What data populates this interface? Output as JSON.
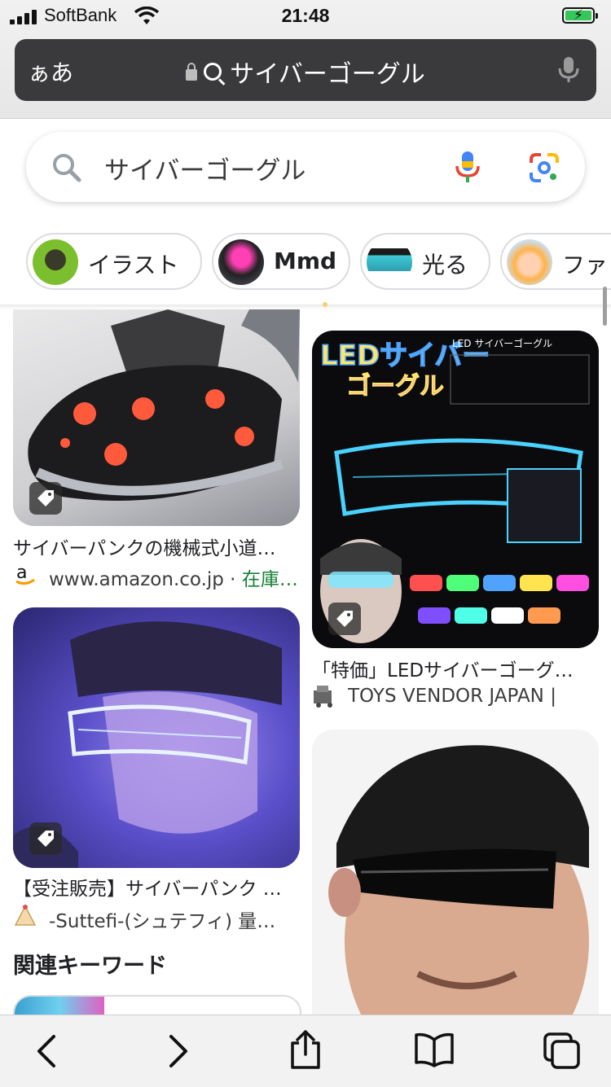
{
  "status_bar": {
    "carrier": "SoftBank",
    "time": "21:48"
  },
  "safari": {
    "text_size_button": "ぁあ",
    "address": "サイバーゴーグル"
  },
  "search": {
    "query": "サイバーゴーグル"
  },
  "chips": [
    {
      "label": "イラスト"
    },
    {
      "label": "Mmd"
    },
    {
      "label": "光る"
    },
    {
      "label": "ファ"
    }
  ],
  "results": [
    {
      "title": "サイバーパンクの機械式小道…",
      "source": "www.amazon.co.jp · ",
      "extra": "在庫…"
    },
    {
      "title": "「特価」LEDサイバーゴーグ…",
      "source": "TOYS VENDOR JAPAN |",
      "extra": ""
    },
    {
      "title": "【受注販売】サイバーパンク …",
      "source": "-Suttefi-(シュテフィ) 量…",
      "extra": ""
    }
  ],
  "poster_text": {
    "headline_line1": "LEDサイバー",
    "headline_line2": "ゴーグル",
    "corner_label": "LED サイバーゴーグル"
  },
  "related_keywords_heading": "関連キーワード",
  "colors": {
    "stock_green": "#188038",
    "chip_border": "#dadce0",
    "url_bar": "#3a3a3c"
  },
  "icons": [
    "search-icon",
    "mic-icon",
    "lens-icon",
    "tag-icon",
    "back-icon",
    "forward-icon",
    "share-icon",
    "bookmarks-icon",
    "tabs-icon"
  ]
}
